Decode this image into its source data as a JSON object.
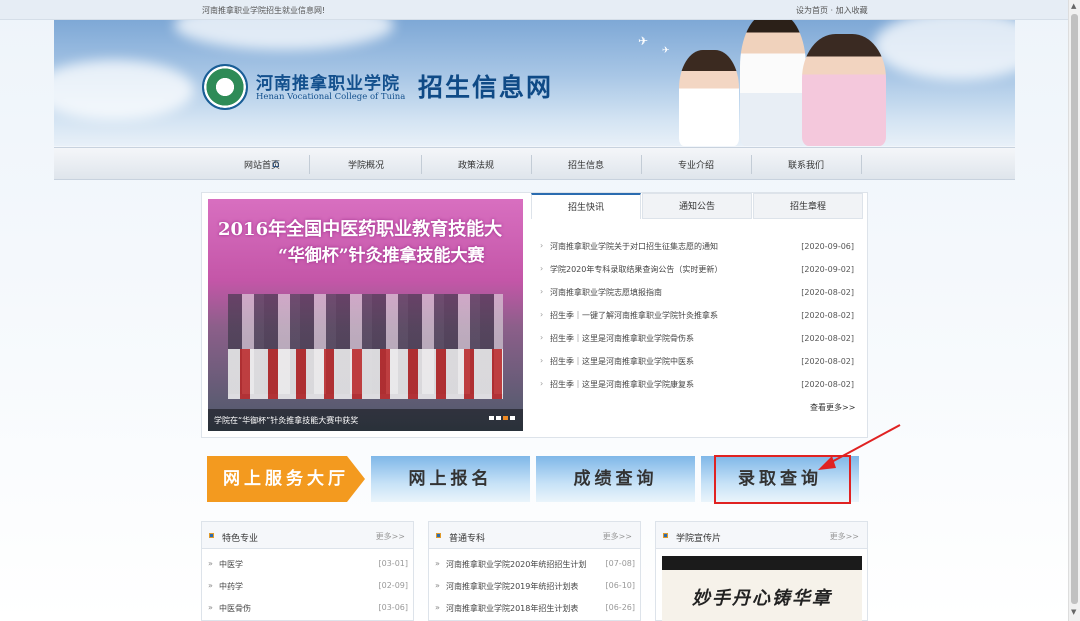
{
  "topbar": {
    "left": "河南推拿职业学院招生就业信息网!",
    "right": "设为首页 · 加入收藏"
  },
  "header": {
    "cn_name": "河南推拿职业学院",
    "en_name": "Henan Vocational College of Tuina",
    "site_name": "招生信息网"
  },
  "nav": [
    "网站首页",
    "学院概况",
    "政策法规",
    "招生信息",
    "专业介绍",
    "联系我们"
  ],
  "slide": {
    "line1": "2016年全国中医药职业教育技能大",
    "line2": "“华御杯”针灸推拿技能大赛",
    "caption": "学院在“华御杯”针灸推拿技能大赛中获奖"
  },
  "tabs": [
    "招生快讯",
    "通知公告",
    "招生章程"
  ],
  "news": [
    {
      "title": "河南推拿职业学院关于对口招生征集志愿的通知",
      "date": "[2020-09-06]"
    },
    {
      "title": "学院2020年专科录取结果查询公告（实时更新）",
      "date": "[2020-09-02]"
    },
    {
      "title": "河南推拿职业学院志愿填报指南",
      "date": "[2020-08-02]"
    },
    {
      "title": "招生季｜一键了解河南推拿职业学院针灸推拿系",
      "date": "[2020-08-02]"
    },
    {
      "title": "招生季｜这里是河南推拿职业学院骨伤系",
      "date": "[2020-08-02]"
    },
    {
      "title": "招生季｜这里是河南推拿职业学院中医系",
      "date": "[2020-08-02]"
    },
    {
      "title": "招生季｜这里是河南推拿职业学院康复系",
      "date": "[2020-08-02]"
    }
  ],
  "news_more": "查看更多>>",
  "services": [
    "网上服务大厅",
    "网上报名",
    "成绩查询",
    "录取查询"
  ],
  "box1": {
    "title": "特色专业",
    "more": "更多>>",
    "items": [
      {
        "t": "中医学",
        "d": "[03-01]"
      },
      {
        "t": "中药学",
        "d": "[02-09]"
      },
      {
        "t": "中医骨伤",
        "d": "[03-06]"
      }
    ]
  },
  "box2": {
    "title": "普通专科",
    "more": "更多>>",
    "items": [
      {
        "t": "河南推拿职业学院2020年统招招生计划",
        "d": "[07-08]"
      },
      {
        "t": "河南推拿职业学院2019年统招计划表",
        "d": "[06-10]"
      },
      {
        "t": "河南推拿职业学院2018年招生计划表",
        "d": "[06-26]"
      }
    ]
  },
  "box3": {
    "title": "学院宣传片",
    "more": "更多>>",
    "promo": "妙手丹心铸华章"
  },
  "colors": {
    "accent": "#2b6cb0",
    "highlight": "#e02222"
  }
}
